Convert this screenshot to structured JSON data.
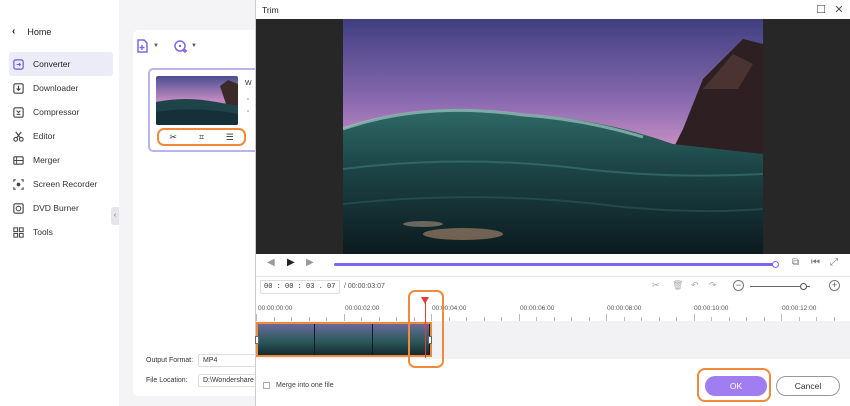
{
  "sidebar": {
    "back_label": "Home",
    "items": [
      {
        "label": "Converter",
        "icon": "converter-icon",
        "active": true
      },
      {
        "label": "Downloader",
        "icon": "downloader-icon"
      },
      {
        "label": "Compressor",
        "icon": "compressor-icon"
      },
      {
        "label": "Editor",
        "icon": "editor-icon"
      },
      {
        "label": "Merger",
        "icon": "merger-icon"
      },
      {
        "label": "Screen Recorder",
        "icon": "screen-recorder-icon"
      },
      {
        "label": "DVD Burner",
        "icon": "dvd-burner-icon"
      },
      {
        "label": "Tools",
        "icon": "tools-icon"
      }
    ]
  },
  "converter": {
    "card_title_initial": "W",
    "output_format_label": "Output Format:",
    "output_format_value": "MP4",
    "file_location_label": "File Location:",
    "file_location_value": "D:\\Wondershare",
    "thumb_tools": [
      "scissors-icon",
      "crop-icon",
      "effects-icon"
    ]
  },
  "trim": {
    "title": "Trim",
    "current_time": "00 : 00 : 03 . 07",
    "duration": "/ 00:00:03:07",
    "ruler_labels": [
      "00:00:00:00",
      "00:00:02:00",
      "00:00:04:00",
      "00:00:06:00",
      "00:00:08:00",
      "00:00:10:00",
      "00:00:12:00"
    ],
    "playback_progress": 1.0,
    "zoom_level": 0.9,
    "merge_label": "Merge into one file",
    "ok_label": "OK",
    "cancel_label": "Cancel"
  },
  "colors": {
    "accent": "#7b68ee",
    "ok_button": "#a07ef2",
    "highlight": "#f08a3a",
    "playhead": "#e53b3b"
  }
}
